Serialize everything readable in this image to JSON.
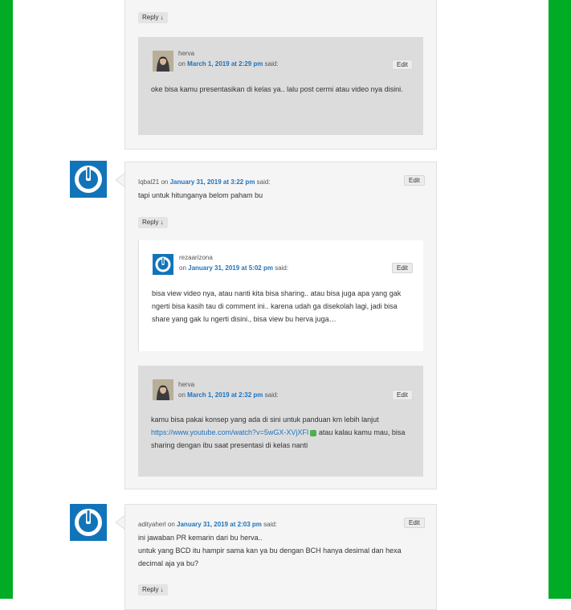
{
  "comment_top_reply": {
    "reply_label": "Reply ↓"
  },
  "reply_herva_1": {
    "author": "herva",
    "on": "on ",
    "date": "March 1, 2019 at 2:29 pm",
    "said": " said:",
    "edit_label": "Edit",
    "body": "oke bisa kamu presentasikan di kelas ya.. lalu post cermi atau video nya disini."
  },
  "comment_iqbal": {
    "author": "Iqbal21",
    "on": " on ",
    "date": "January 31, 2019 at 3:22 pm",
    "said": " said:",
    "edit_label": "Edit",
    "body": "tapi untuk hitunganya belom paham bu",
    "reply_label": "Reply ↓"
  },
  "reply_rezaarizona": {
    "author": "rezaarizona",
    "on": "on ",
    "date": "January 31, 2019 at 5:02 pm",
    "said": " said:",
    "edit_label": "Edit",
    "body": "bisa view video nya, atau nanti kita bisa sharing.. atau bisa juga apa yang gak ngerti bisa kasih tau di comment ini.. karena udah ga disekolah lagi, jadi bisa share yang gak lu ngerti disini., bisa view bu herva juga…"
  },
  "reply_herva_2": {
    "author": "herva",
    "on": "on ",
    "date": "March 1, 2019 at 2:32 pm",
    "said": " said:",
    "edit_label": "Edit",
    "body_before": "kamu bisa pakai konsep yang ada di sini untuk panduan km lebih lanjut",
    "link": "https://www.youtube.com/watch?v=5wGX-XVjXFI",
    "body_after": " atau kalau kamu mau, bisa sharing dengan ibu saat presentasi di kelas nanti"
  },
  "comment_adityaherl": {
    "author": "adityaherl",
    "on": " on ",
    "date": "January 31, 2019 at 2:03 pm",
    "said": " said:",
    "edit_label": "Edit",
    "body_line1": "ini jawaban PR kemarin dari bu herva..",
    "body_line2": "untuk yang BCD itu hampir sama kan ya bu dengan BCH hanya desimal dan hexa decimal aja ya bu?",
    "reply_label": "Reply ↓"
  }
}
